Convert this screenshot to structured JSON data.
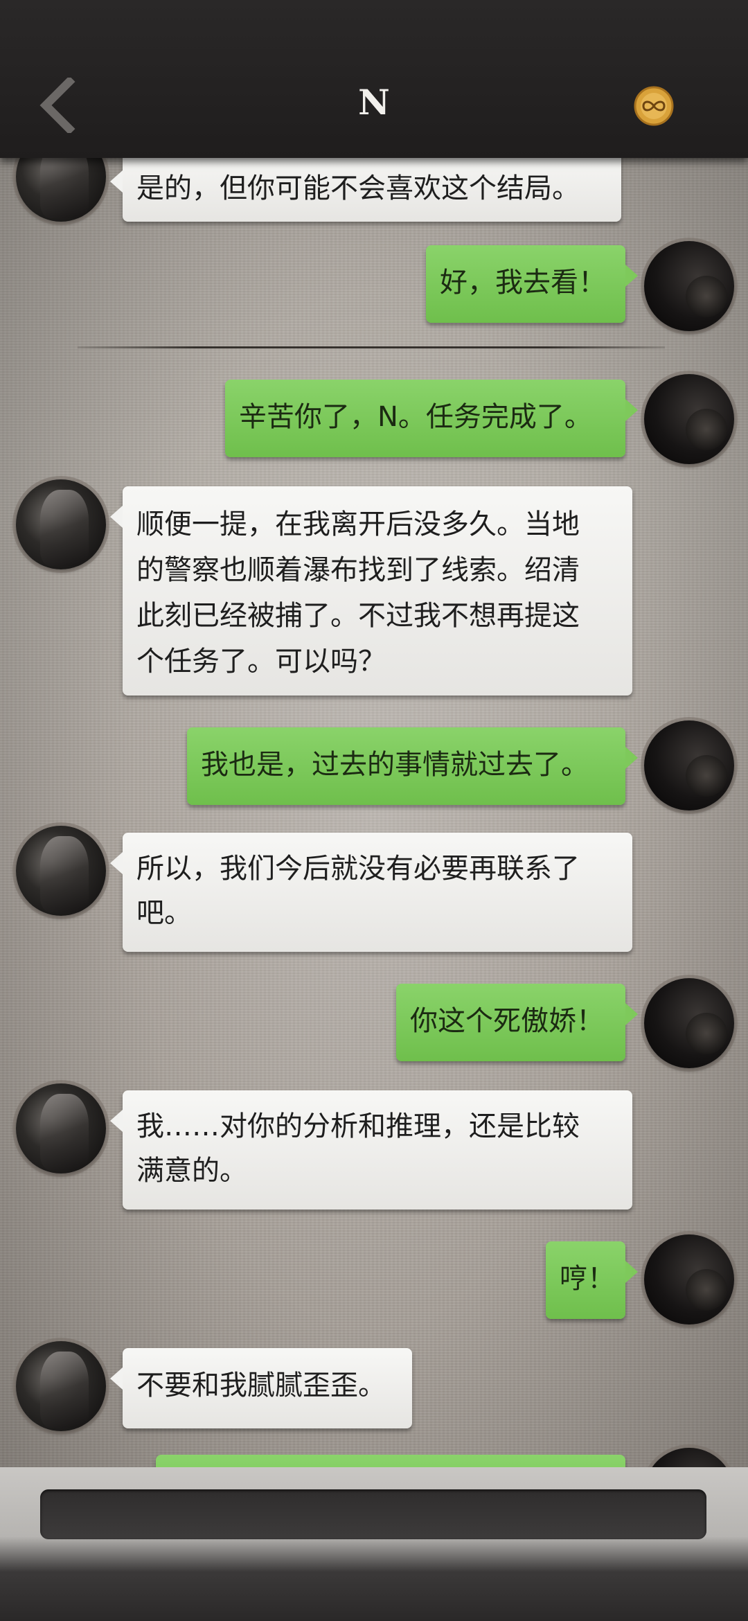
{
  "header": {
    "title": "N",
    "back_icon": "chevron-left-icon",
    "coin_icon": "infinity-coin-icon",
    "coin_color": "#d9a23a"
  },
  "messages": [
    {
      "from": "other",
      "text": "是的，但你可能不会喜欢这个结局。"
    },
    {
      "from": "me",
      "text": "好，我去看！"
    },
    {
      "from": "me",
      "text": "辛苦你了，N。任务完成了。"
    },
    {
      "from": "other",
      "lines": [
        "顺便一提，在我离开后没多久。当地",
        "的警察也顺着瀑布找到了线索。绍清",
        "此刻已经被捕了。不过我不想再提这",
        "个任务了。可以吗？"
      ]
    },
    {
      "from": "me",
      "text": "我也是，过去的事情就过去了。"
    },
    {
      "from": "other",
      "lines": [
        "所以，我们今后就没有必要再联系了",
        "吧。"
      ]
    },
    {
      "from": "me",
      "text": "你这个死傲娇！"
    },
    {
      "from": "other",
      "lines": [
        "我……对你的分析和推理，还是比较",
        "满意的。"
      ]
    },
    {
      "from": "me",
      "text": "哼！"
    },
    {
      "from": "other",
      "text": "不要和我腻腻歪歪。"
    }
  ],
  "input": {
    "placeholder": "",
    "value": ""
  },
  "colors": {
    "my_bubble": "#7ec95b",
    "other_bubble": "#f2f2f0",
    "header": "#232121"
  }
}
